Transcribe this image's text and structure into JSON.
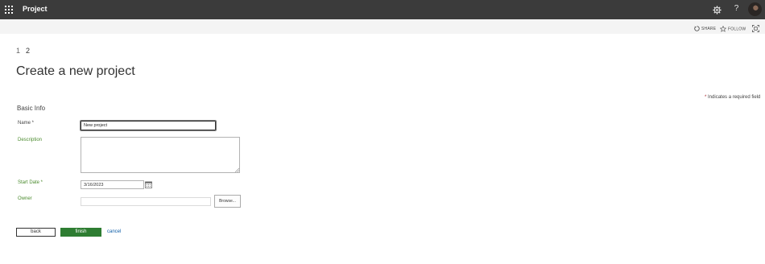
{
  "suite_bar": {
    "app_title": "Project",
    "icons": [
      "waffle-icon",
      "gear-icon",
      "help-icon",
      "avatar"
    ],
    "help_glyph": "?"
  },
  "command_bar": {
    "share_label": "SHARE",
    "follow_label": "FOLLOW",
    "icons": [
      "share-icon",
      "star-icon",
      "focus-mode-icon"
    ]
  },
  "wizard": {
    "steps": [
      "1",
      "2"
    ],
    "current_step": "2"
  },
  "page_title": "Create a new project",
  "required_note": {
    "star": "*",
    "text": "Indicates a required field"
  },
  "form": {
    "section_heading": "Basic Info",
    "fields": {
      "name": {
        "label": "Name *",
        "value": "New project"
      },
      "description": {
        "label": "Description",
        "value": ""
      },
      "start_date": {
        "label": "Start Date *",
        "value": "3/16/2023"
      },
      "owner": {
        "label": "Owner",
        "value": "",
        "browse_label": "Browse..."
      }
    }
  },
  "actions": {
    "back_label": "back",
    "finish_label": "finish",
    "cancel_label": "cancel"
  },
  "colors": {
    "suite_bar": "#3b3b3b",
    "command_bar": "#f4f4f4",
    "finish_button": "#2e7d32",
    "green_label": "#4b8b2e",
    "link": "#0f5ea8"
  }
}
